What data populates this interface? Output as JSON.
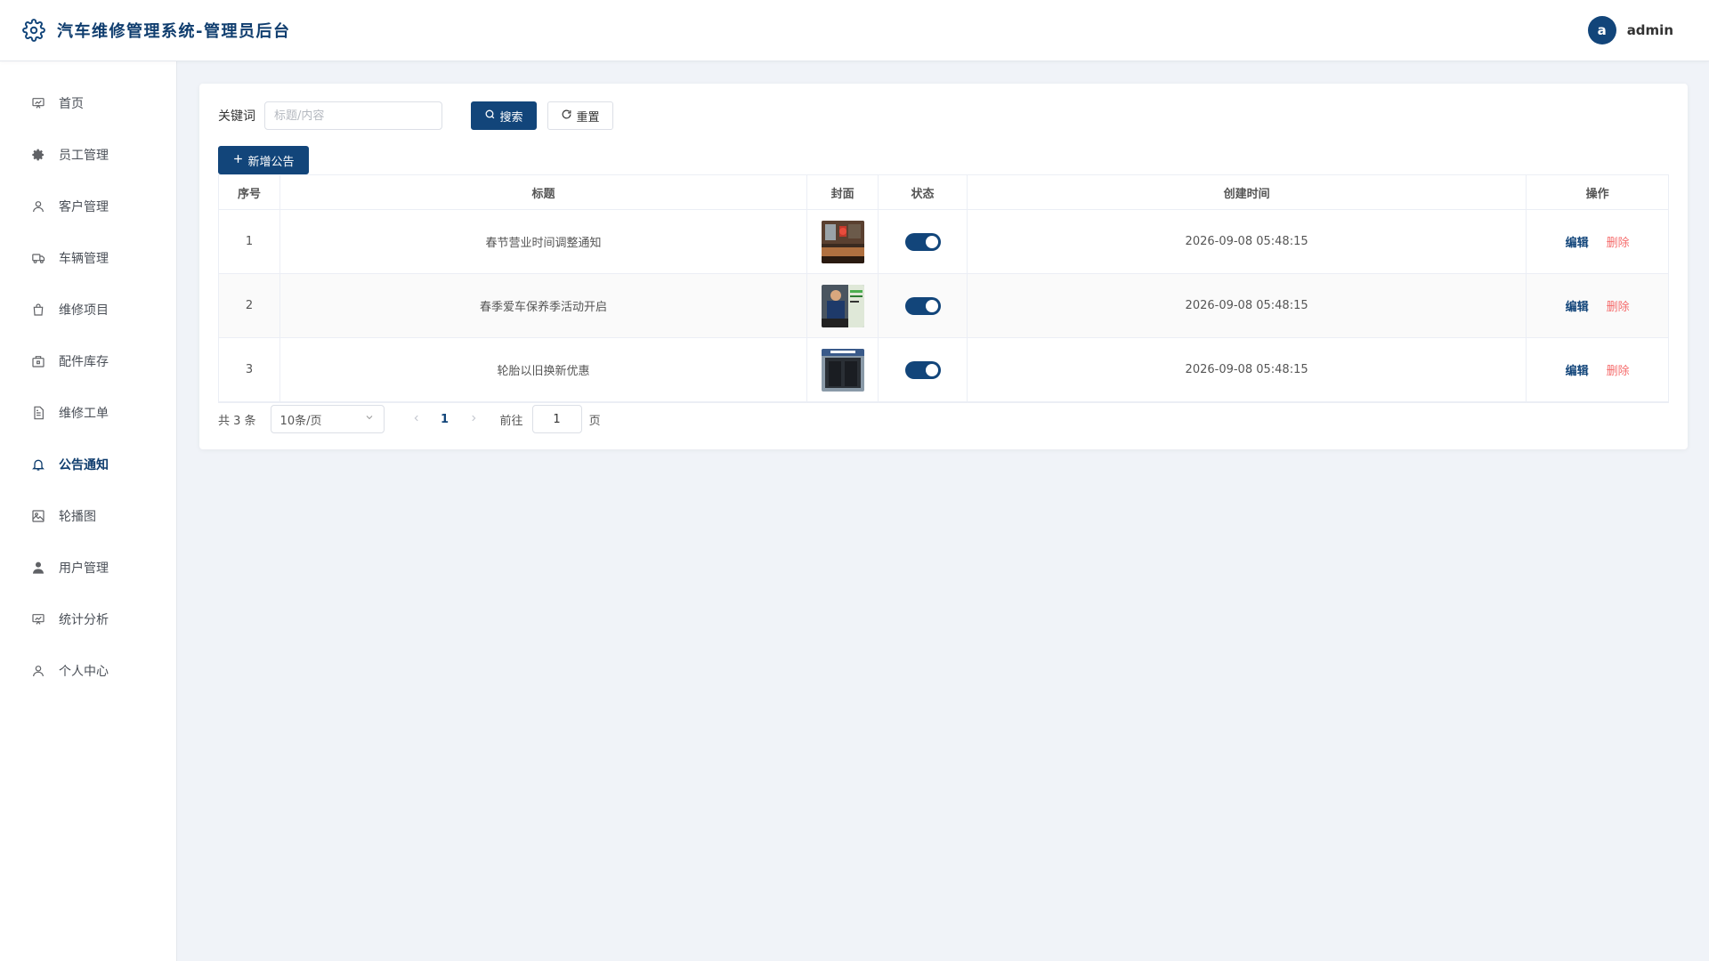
{
  "header": {
    "title": "汽车维修管理系统-管理员后台",
    "avatar_letter": "a",
    "username": "admin",
    "brand_icon": "gear-icon"
  },
  "sidebar": {
    "items": [
      {
        "label": "首页",
        "icon": "presentation-board-icon"
      },
      {
        "label": "员工管理",
        "icon": "cog-icon"
      },
      {
        "label": "客户管理",
        "icon": "user-outline-icon"
      },
      {
        "label": "车辆管理",
        "icon": "truck-icon"
      },
      {
        "label": "维修项目",
        "icon": "shopping-bag-icon"
      },
      {
        "label": "配件库存",
        "icon": "box-icon"
      },
      {
        "label": "维修工单",
        "icon": "document-icon"
      },
      {
        "label": "公告通知",
        "icon": "bell-icon",
        "active": true
      },
      {
        "label": "轮播图",
        "icon": "picture-icon"
      },
      {
        "label": "用户管理",
        "icon": "user-filled-icon"
      },
      {
        "label": "统计分析",
        "icon": "presentation-chart-icon"
      },
      {
        "label": "个人中心",
        "icon": "user-outline-icon"
      }
    ]
  },
  "search": {
    "label": "关键词",
    "placeholder": "标题/内容",
    "value": "",
    "search_label": "搜索",
    "reset_label": "重置",
    "add_label": "新增公告"
  },
  "table": {
    "headers": {
      "index": "序号",
      "title": "标题",
      "cover": "封面",
      "status": "状态",
      "created": "创建时间",
      "ops": "操作"
    },
    "rows": [
      {
        "index": "1",
        "title": "春节营业时间调整通知",
        "created": "2026-09-08 05:48:15",
        "status_on": true,
        "edit": "编辑",
        "delete": "删除"
      },
      {
        "index": "2",
        "title": "春季爱车保养季活动开启",
        "created": "2026-09-08 05:48:15",
        "status_on": true,
        "edit": "编辑",
        "delete": "删除"
      },
      {
        "index": "3",
        "title": "轮胎以旧换新优惠",
        "created": "2026-09-08 05:48:15",
        "status_on": true,
        "edit": "编辑",
        "delete": "删除"
      }
    ]
  },
  "pagination": {
    "total_text": "共 3 条",
    "page_size": "10条/页",
    "current_page": "1",
    "goto_prefix": "前往",
    "goto_value": "1",
    "goto_suffix": "页"
  },
  "colors": {
    "primary": "#12457a",
    "danger": "#f56c6c",
    "background": "#f0f3f8"
  }
}
